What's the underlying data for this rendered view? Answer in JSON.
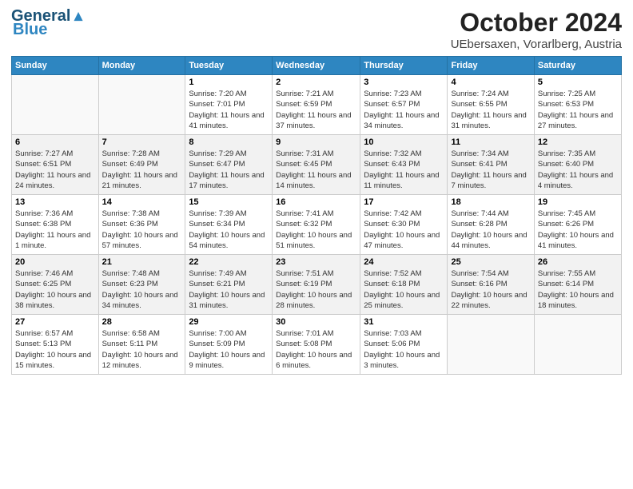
{
  "logo": {
    "line1": "General",
    "line2": "Blue"
  },
  "title": "October 2024",
  "subtitle": "UEbersaxen, Vorarlberg, Austria",
  "weekdays": [
    "Sunday",
    "Monday",
    "Tuesday",
    "Wednesday",
    "Thursday",
    "Friday",
    "Saturday"
  ],
  "days": [
    {
      "date": 1,
      "sunrise": "7:20 AM",
      "sunset": "7:01 PM",
      "daylight": "11 hours and 41 minutes."
    },
    {
      "date": 2,
      "sunrise": "7:21 AM",
      "sunset": "6:59 PM",
      "daylight": "11 hours and 37 minutes."
    },
    {
      "date": 3,
      "sunrise": "7:23 AM",
      "sunset": "6:57 PM",
      "daylight": "11 hours and 34 minutes."
    },
    {
      "date": 4,
      "sunrise": "7:24 AM",
      "sunset": "6:55 PM",
      "daylight": "11 hours and 31 minutes."
    },
    {
      "date": 5,
      "sunrise": "7:25 AM",
      "sunset": "6:53 PM",
      "daylight": "11 hours and 27 minutes."
    },
    {
      "date": 6,
      "sunrise": "7:27 AM",
      "sunset": "6:51 PM",
      "daylight": "11 hours and 24 minutes."
    },
    {
      "date": 7,
      "sunrise": "7:28 AM",
      "sunset": "6:49 PM",
      "daylight": "11 hours and 21 minutes."
    },
    {
      "date": 8,
      "sunrise": "7:29 AM",
      "sunset": "6:47 PM",
      "daylight": "11 hours and 17 minutes."
    },
    {
      "date": 9,
      "sunrise": "7:31 AM",
      "sunset": "6:45 PM",
      "daylight": "11 hours and 14 minutes."
    },
    {
      "date": 10,
      "sunrise": "7:32 AM",
      "sunset": "6:43 PM",
      "daylight": "11 hours and 11 minutes."
    },
    {
      "date": 11,
      "sunrise": "7:34 AM",
      "sunset": "6:41 PM",
      "daylight": "11 hours and 7 minutes."
    },
    {
      "date": 12,
      "sunrise": "7:35 AM",
      "sunset": "6:40 PM",
      "daylight": "11 hours and 4 minutes."
    },
    {
      "date": 13,
      "sunrise": "7:36 AM",
      "sunset": "6:38 PM",
      "daylight": "11 hours and 1 minute."
    },
    {
      "date": 14,
      "sunrise": "7:38 AM",
      "sunset": "6:36 PM",
      "daylight": "10 hours and 57 minutes."
    },
    {
      "date": 15,
      "sunrise": "7:39 AM",
      "sunset": "6:34 PM",
      "daylight": "10 hours and 54 minutes."
    },
    {
      "date": 16,
      "sunrise": "7:41 AM",
      "sunset": "6:32 PM",
      "daylight": "10 hours and 51 minutes."
    },
    {
      "date": 17,
      "sunrise": "7:42 AM",
      "sunset": "6:30 PM",
      "daylight": "10 hours and 47 minutes."
    },
    {
      "date": 18,
      "sunrise": "7:44 AM",
      "sunset": "6:28 PM",
      "daylight": "10 hours and 44 minutes."
    },
    {
      "date": 19,
      "sunrise": "7:45 AM",
      "sunset": "6:26 PM",
      "daylight": "10 hours and 41 minutes."
    },
    {
      "date": 20,
      "sunrise": "7:46 AM",
      "sunset": "6:25 PM",
      "daylight": "10 hours and 38 minutes."
    },
    {
      "date": 21,
      "sunrise": "7:48 AM",
      "sunset": "6:23 PM",
      "daylight": "10 hours and 34 minutes."
    },
    {
      "date": 22,
      "sunrise": "7:49 AM",
      "sunset": "6:21 PM",
      "daylight": "10 hours and 31 minutes."
    },
    {
      "date": 23,
      "sunrise": "7:51 AM",
      "sunset": "6:19 PM",
      "daylight": "10 hours and 28 minutes."
    },
    {
      "date": 24,
      "sunrise": "7:52 AM",
      "sunset": "6:18 PM",
      "daylight": "10 hours and 25 minutes."
    },
    {
      "date": 25,
      "sunrise": "7:54 AM",
      "sunset": "6:16 PM",
      "daylight": "10 hours and 22 minutes."
    },
    {
      "date": 26,
      "sunrise": "7:55 AM",
      "sunset": "6:14 PM",
      "daylight": "10 hours and 18 minutes."
    },
    {
      "date": 27,
      "sunrise": "6:57 AM",
      "sunset": "5:13 PM",
      "daylight": "10 hours and 15 minutes."
    },
    {
      "date": 28,
      "sunrise": "6:58 AM",
      "sunset": "5:11 PM",
      "daylight": "10 hours and 12 minutes."
    },
    {
      "date": 29,
      "sunrise": "7:00 AM",
      "sunset": "5:09 PM",
      "daylight": "10 hours and 9 minutes."
    },
    {
      "date": 30,
      "sunrise": "7:01 AM",
      "sunset": "5:08 PM",
      "daylight": "10 hours and 6 minutes."
    },
    {
      "date": 31,
      "sunrise": "7:03 AM",
      "sunset": "5:06 PM",
      "daylight": "10 hours and 3 minutes."
    }
  ]
}
